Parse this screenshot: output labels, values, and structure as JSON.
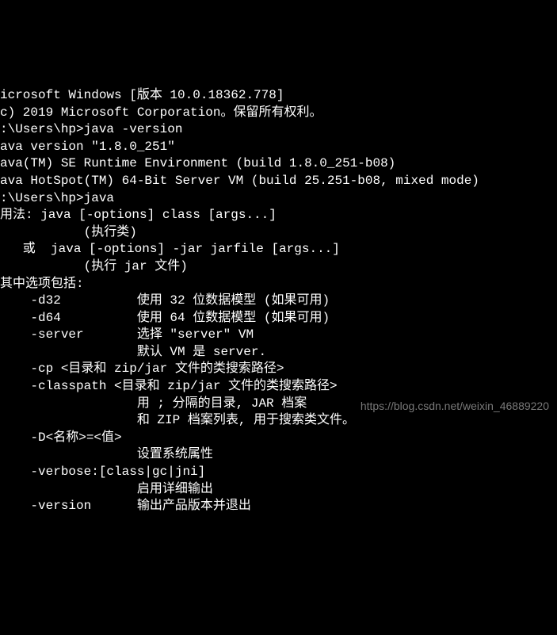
{
  "terminal": {
    "lines": [
      "icrosoft Windows [版本 10.0.18362.778]",
      "c) 2019 Microsoft Corporation。保留所有权利。",
      "",
      ":\\Users\\hp>java -version",
      "ava version \"1.8.0_251\"",
      "ava(TM) SE Runtime Environment (build 1.8.0_251-b08)",
      "ava HotSpot(TM) 64-Bit Server VM (build 25.251-b08, mixed mode)",
      "",
      ":\\Users\\hp>java",
      "用法: java [-options] class [args...]",
      "           (执行类)",
      "   或  java [-options] -jar jarfile [args...]",
      "           (执行 jar 文件)",
      "其中选项包括:",
      "    -d32          使用 32 位数据模型 (如果可用)",
      "    -d64          使用 64 位数据模型 (如果可用)",
      "    -server       选择 \"server\" VM",
      "                  默认 VM 是 server.",
      "",
      "    -cp <目录和 zip/jar 文件的类搜索路径>",
      "    -classpath <目录和 zip/jar 文件的类搜索路径>",
      "                  用 ; 分隔的目录, JAR 档案",
      "                  和 ZIP 档案列表, 用于搜索类文件。",
      "    -D<名称>=<值>",
      "                  设置系统属性",
      "    -verbose:[class|gc|jni]",
      "                  启用详细输出",
      "    -version      输出产品版本并退出"
    ]
  },
  "watermark": {
    "text": "https://blog.csdn.net/weixin_46889220"
  }
}
